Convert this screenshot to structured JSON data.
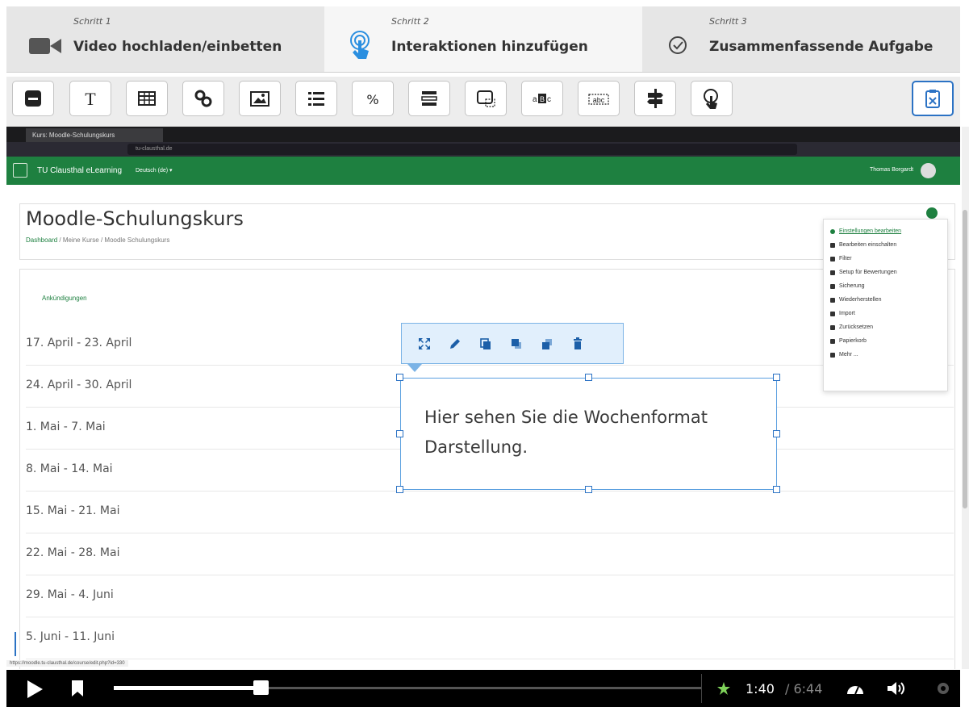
{
  "wizard": {
    "steps": [
      {
        "label": "Schritt 1",
        "title": "Video hochladen/einbetten",
        "icon": "video-camera-icon"
      },
      {
        "label": "Schritt 2",
        "title": "Interaktionen hinzufügen",
        "icon": "touch-hand-icon"
      },
      {
        "label": "Schritt 3",
        "title": "Zusammenfassende Aufgabe",
        "icon": "check-circle-icon"
      }
    ],
    "active_step": 2
  },
  "toolbar": {
    "buttons": [
      "label-icon",
      "text-icon",
      "table-icon",
      "link-icon",
      "image-icon",
      "statements-icon",
      "percent-icon",
      "single-choice-set-icon",
      "navigation-hotspot-icon",
      "fill-blanks-icon",
      "drag-text-icon",
      "crossroads-icon",
      "mark-words-icon"
    ],
    "right_button": "paste-icon"
  },
  "browser": {
    "tab_title": "Kurs: Moodle-Schulungskurs",
    "url_domain": "tu-clausthal.de",
    "status_url": "https://moodle.tu-clausthal.de/course/edit.php?id=330"
  },
  "moodle": {
    "site_name": "TU Clausthal eLearning",
    "language": "Deutsch (de) ▾",
    "user_name": "Thomas Borgardt",
    "course_title": "Moodle-Schulungskurs",
    "breadcrumb": {
      "dashboard": "Dashboard",
      "sep": " / ",
      "my_courses": "Meine Kurse",
      "course": "Moodle Schulungskurs"
    },
    "announcements": "Ankündigungen",
    "weeks": [
      "17. April - 23. April",
      "24. April - 30. April",
      "1. Mai - 7. Mai",
      "8. Mai - 14. Mai",
      "15. Mai - 21. Mai",
      "22. Mai - 28. Mai",
      "29. Mai - 4. Juni",
      "5. Juni - 11. Juni"
    ],
    "menu": [
      "Einstellungen bearbeiten",
      "Bearbeiten einschalten",
      "Filter",
      "Setup für Bewertungen",
      "Sicherung",
      "Wiederherstellen",
      "Import",
      "Zurücksetzen",
      "Papierkorb",
      "Mehr ..."
    ]
  },
  "interaction": {
    "text": "Hier sehen Sie die Wochenformat Darstellung.",
    "context_actions": [
      "fullscreen-icon",
      "edit-icon",
      "copy-icon",
      "bring-front-icon",
      "send-back-icon",
      "delete-icon"
    ]
  },
  "player": {
    "current_time": "1:40",
    "separator": " / ",
    "duration": "6:44",
    "progress": 0.25
  },
  "colors": {
    "moodle_green": "#1e8040",
    "accent_blue": "#2b72c4"
  }
}
